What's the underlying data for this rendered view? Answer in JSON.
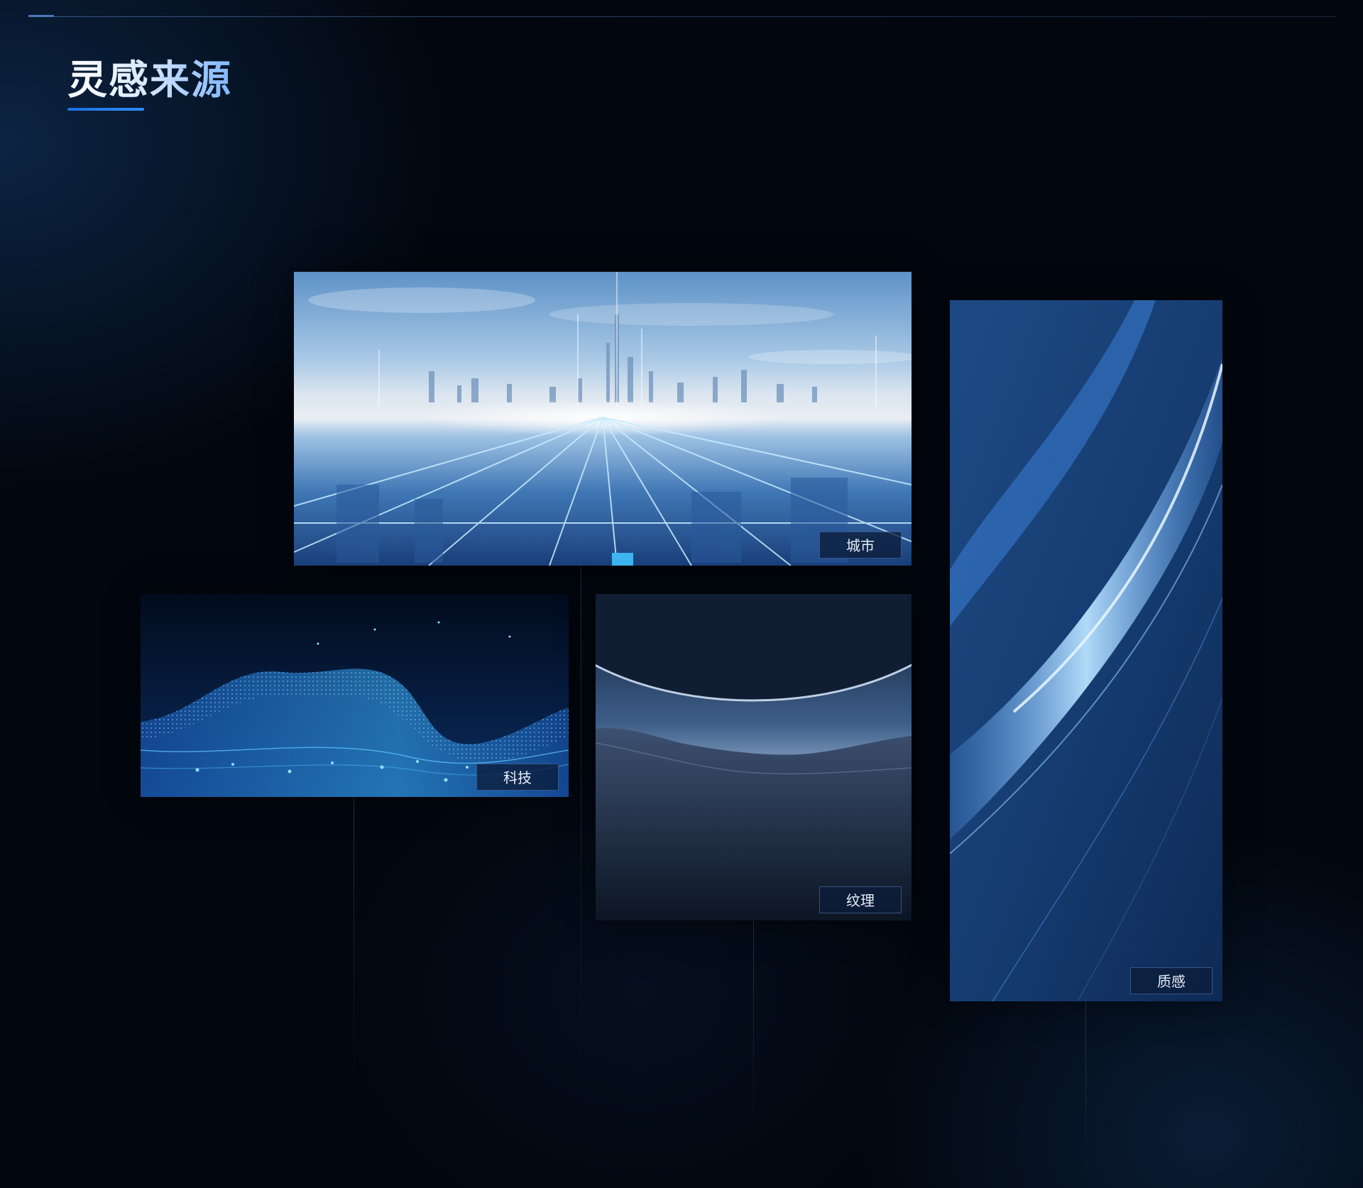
{
  "page": {
    "title": "灵感来源"
  },
  "cards": [
    {
      "id": "city",
      "label": "城市"
    },
    {
      "id": "tech",
      "label": "科技"
    },
    {
      "id": "texture",
      "label": "纹理"
    },
    {
      "id": "material",
      "label": "质感"
    }
  ],
  "colors": {
    "background": "#02070f",
    "accent": "#2f8cff",
    "title_gradient_end": "#7fb6ff"
  }
}
